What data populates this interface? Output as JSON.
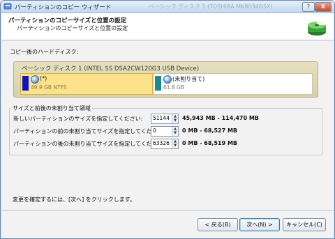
{
  "window": {
    "title": "パーティションのコピー ウィザード",
    "ghost_title": "ベーシック ディスク 1 (TOSHIBA MK8034GSX)",
    "help_label": "?",
    "close_label": "X"
  },
  "header": {
    "title": "パーティションのコピーサイズと位置の設定",
    "subtitle": "パーティションのコピーサイズと位置の設定"
  },
  "disk_section": {
    "label": "コピー後のハードディスク:",
    "disk_name": "ベーシック ディスク 1 (INTEL SS DSA2CW120G3 USB Device)",
    "partitions": [
      {
        "label": "(*)",
        "size": "49.9 GB NTFS",
        "color": "#0c15c4"
      },
      {
        "label": "(未割り当て)",
        "size": "61.8 GB",
        "color": "#1c8a8f"
      }
    ]
  },
  "size_group": {
    "legend": "サイズと前後の未割り当て領域",
    "rows": [
      {
        "label": "新しいパーティションのサイズを指定してください:",
        "value": "51144",
        "range": "45,943 MB - 114,470 MB"
      },
      {
        "label": "パーティションの前の未割り当てサイズを指定してください:",
        "value": "0",
        "range": "0 MB - 68,527 MB"
      },
      {
        "label": "パーティションの後の未割り当てサイズを指定してください:",
        "value": "63326",
        "range": "0 MB - 68,519 MB"
      }
    ]
  },
  "footer_text": "変更を確定するには、[次へ] をクリックします。",
  "buttons": {
    "back": "< 戻る(B)",
    "next": "次へ(N) >",
    "cancel": "キャンセル(C)"
  },
  "colors": {
    "partition_selected_bg": "#fde28c",
    "disk_box_bg": "#d8d0a6",
    "title_bar": "#c3d7ef"
  }
}
